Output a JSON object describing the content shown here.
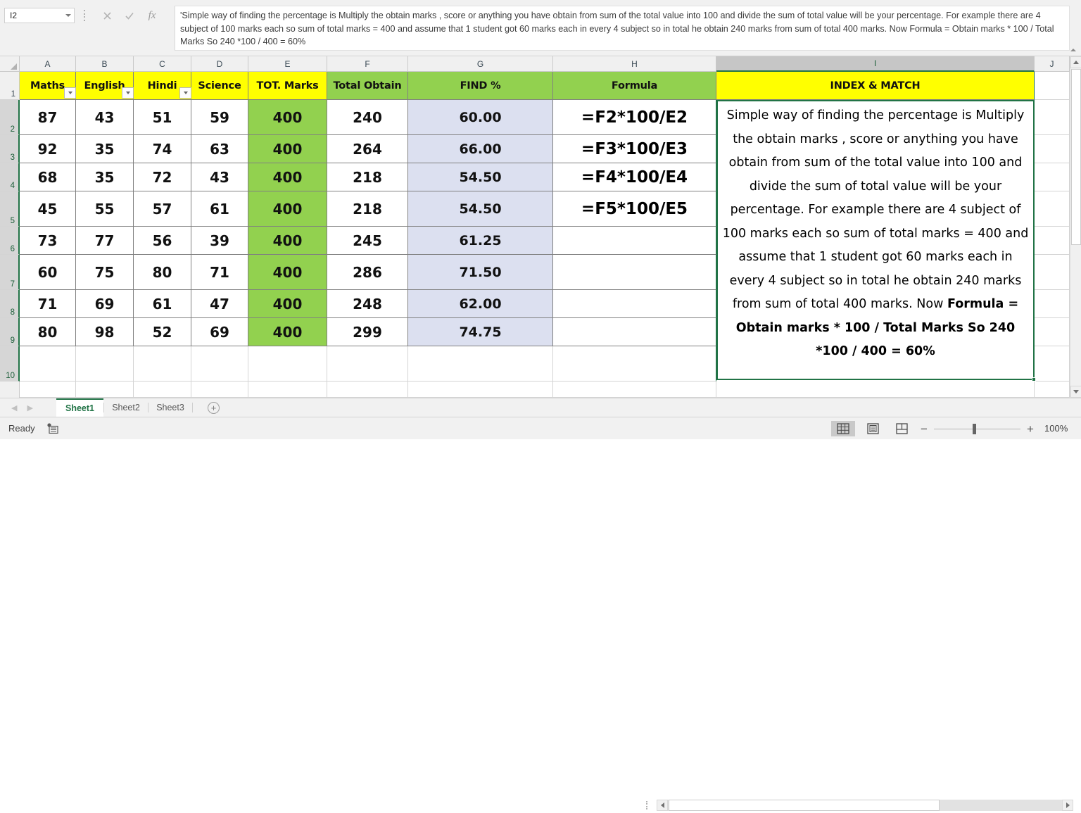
{
  "formula_bar": {
    "name_box_value": "I2",
    "cancel_icon": "close-icon",
    "enter_icon": "check-icon",
    "fx_label": "fx",
    "formula_value": "'Simple way of finding the percentage is Multiply the obtain marks , score or anything you have obtain from sum of the total value into 100 and divide the sum of total value will be your percentage. For example there are 4 subject of 100 marks each so sum of total marks = 400 and assume that 1 student got 60 marks each in every 4 subject so in total he obtain 240 marks from sum of total 400 marks. Now Formula = Obtain marks * 100 / Total Marks So 240 *100 / 400 = 60%"
  },
  "grid": {
    "column_headers": [
      "A",
      "B",
      "C",
      "D",
      "E",
      "F",
      "G",
      "H",
      "I",
      "J"
    ],
    "selected_column": "I",
    "row_headers": [
      "1",
      "2",
      "3",
      "4",
      "5",
      "6",
      "7",
      "8",
      "9",
      "10"
    ],
    "header_row": {
      "A": "Maths",
      "B": "English",
      "C": "Hindi",
      "D": "Science",
      "E": "TOT. Marks",
      "F": "Total Obtain",
      "G": "FIND %",
      "H": "Formula",
      "I": "INDEX & MATCH"
    },
    "filter_columns": [
      "A",
      "B",
      "C"
    ],
    "rows": [
      {
        "row": "2",
        "maths": "87",
        "english": "43",
        "hindi": "51",
        "science": "59",
        "tot": "400",
        "obtain": "240",
        "find": "60.00",
        "formula": "=F2*100/E2"
      },
      {
        "row": "3",
        "maths": "92",
        "english": "35",
        "hindi": "74",
        "science": "63",
        "tot": "400",
        "obtain": "264",
        "find": "66.00",
        "formula": "=F3*100/E3"
      },
      {
        "row": "4",
        "maths": "68",
        "english": "35",
        "hindi": "72",
        "science": "43",
        "tot": "400",
        "obtain": "218",
        "find": "54.50",
        "formula": "=F4*100/E4"
      },
      {
        "row": "5",
        "maths": "45",
        "english": "55",
        "hindi": "57",
        "science": "61",
        "tot": "400",
        "obtain": "218",
        "find": "54.50",
        "formula": "=F5*100/E5"
      },
      {
        "row": "6",
        "maths": "73",
        "english": "77",
        "hindi": "56",
        "science": "39",
        "tot": "400",
        "obtain": "245",
        "find": "61.25",
        "formula": ""
      },
      {
        "row": "7",
        "maths": "60",
        "english": "75",
        "hindi": "80",
        "science": "71",
        "tot": "400",
        "obtain": "286",
        "find": "71.50",
        "formula": ""
      },
      {
        "row": "8",
        "maths": "71",
        "english": "69",
        "hindi": "61",
        "science": "47",
        "tot": "400",
        "obtain": "248",
        "find": "62.00",
        "formula": ""
      },
      {
        "row": "9",
        "maths": "80",
        "english": "98",
        "hindi": "52",
        "science": "69",
        "tot": "400",
        "obtain": "299",
        "find": "74.75",
        "formula": ""
      }
    ],
    "index_match_cell": {
      "normal_text": "Simple way of finding the percentage is Multiply the obtain marks , score or anything you have obtain from sum of the total value into 100 and divide the sum of total value will be your percentage. For example there are 4 subject of 100 marks each so sum of total marks = 400 and assume that 1 student got 60 marks each in every 4 subject so in total he obtain 240 marks from sum of total 400 marks. Now ",
      "bold_text": "Formula = Obtain marks * 100 / Total Marks So 240 *100 / 400 = 60%"
    }
  },
  "colors": {
    "header_yellow": "#ffff00",
    "header_green": "#92d14f",
    "percent_blue": "#dce0f0",
    "excel_green": "#217346"
  },
  "sheet_tabs": {
    "tabs": [
      "Sheet1",
      "Sheet2",
      "Sheet3"
    ],
    "active": "Sheet1",
    "add_label": "+",
    "prev_icon": "chevron-left-icon",
    "next_icon": "chevron-right-icon"
  },
  "status_bar": {
    "status": "Ready",
    "view_normal": "normal-view-icon",
    "view_page_layout": "page-layout-icon",
    "view_page_break": "page-break-icon",
    "zoom_out": "−",
    "zoom_in": "+",
    "zoom_level": "100%"
  }
}
